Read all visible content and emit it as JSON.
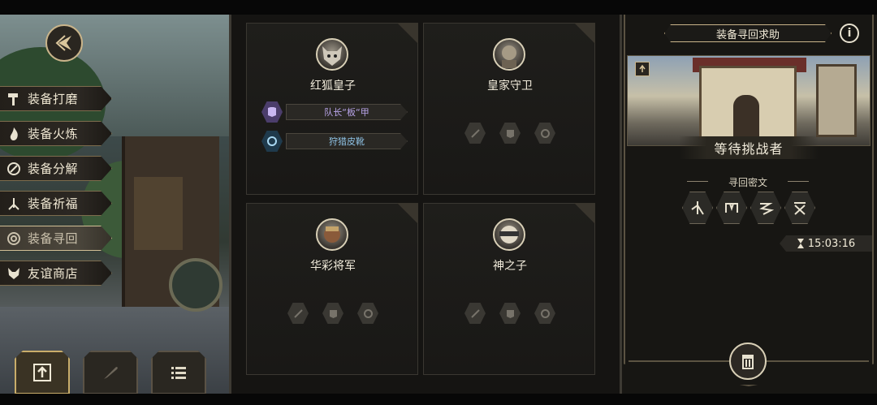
{
  "side_menu": {
    "items": [
      {
        "label": "装备打磨",
        "icon": "hammer-icon"
      },
      {
        "label": "装备火炼",
        "icon": "flame-icon"
      },
      {
        "label": "装备分解",
        "icon": "swirl-icon"
      },
      {
        "label": "装备祈福",
        "icon": "pray-icon"
      },
      {
        "label": "装备寻回",
        "icon": "spiral-icon",
        "active": true
      },
      {
        "label": "友谊商店",
        "icon": "fox-icon"
      }
    ]
  },
  "bottom_tabs": [
    "upload-icon",
    "feather-icon",
    "list-icon"
  ],
  "slots": [
    {
      "name": "红狐皇子",
      "portrait": "wolf-portrait",
      "gear": [
        {
          "label": "队长“板“甲",
          "rarity": "purple",
          "icon": "armor-icon"
        },
        {
          "label": "狩猎皮靴",
          "rarity": "blue",
          "icon": "ring-icon"
        }
      ]
    },
    {
      "name": "皇家守卫",
      "portrait": "guard-portrait",
      "gear": []
    },
    {
      "name": "华彩将军",
      "portrait": "general-portrait",
      "gear": []
    },
    {
      "name": "神之子",
      "portrait": "child-portrait",
      "gear": []
    }
  ],
  "right_panel": {
    "title": "装备寻回求助",
    "info": "i",
    "status": "等待挑战者",
    "cipher_label": "寻回密文",
    "runes": [
      "rune-1",
      "rune-2",
      "rune-3",
      "rune-4"
    ],
    "timer": "15:03:16"
  },
  "colors": {
    "accent_gold": "#c9b48a",
    "purple_rarity": "#b9a5ea",
    "blue_rarity": "#8fc3e6",
    "panel_bg": "#151412"
  }
}
